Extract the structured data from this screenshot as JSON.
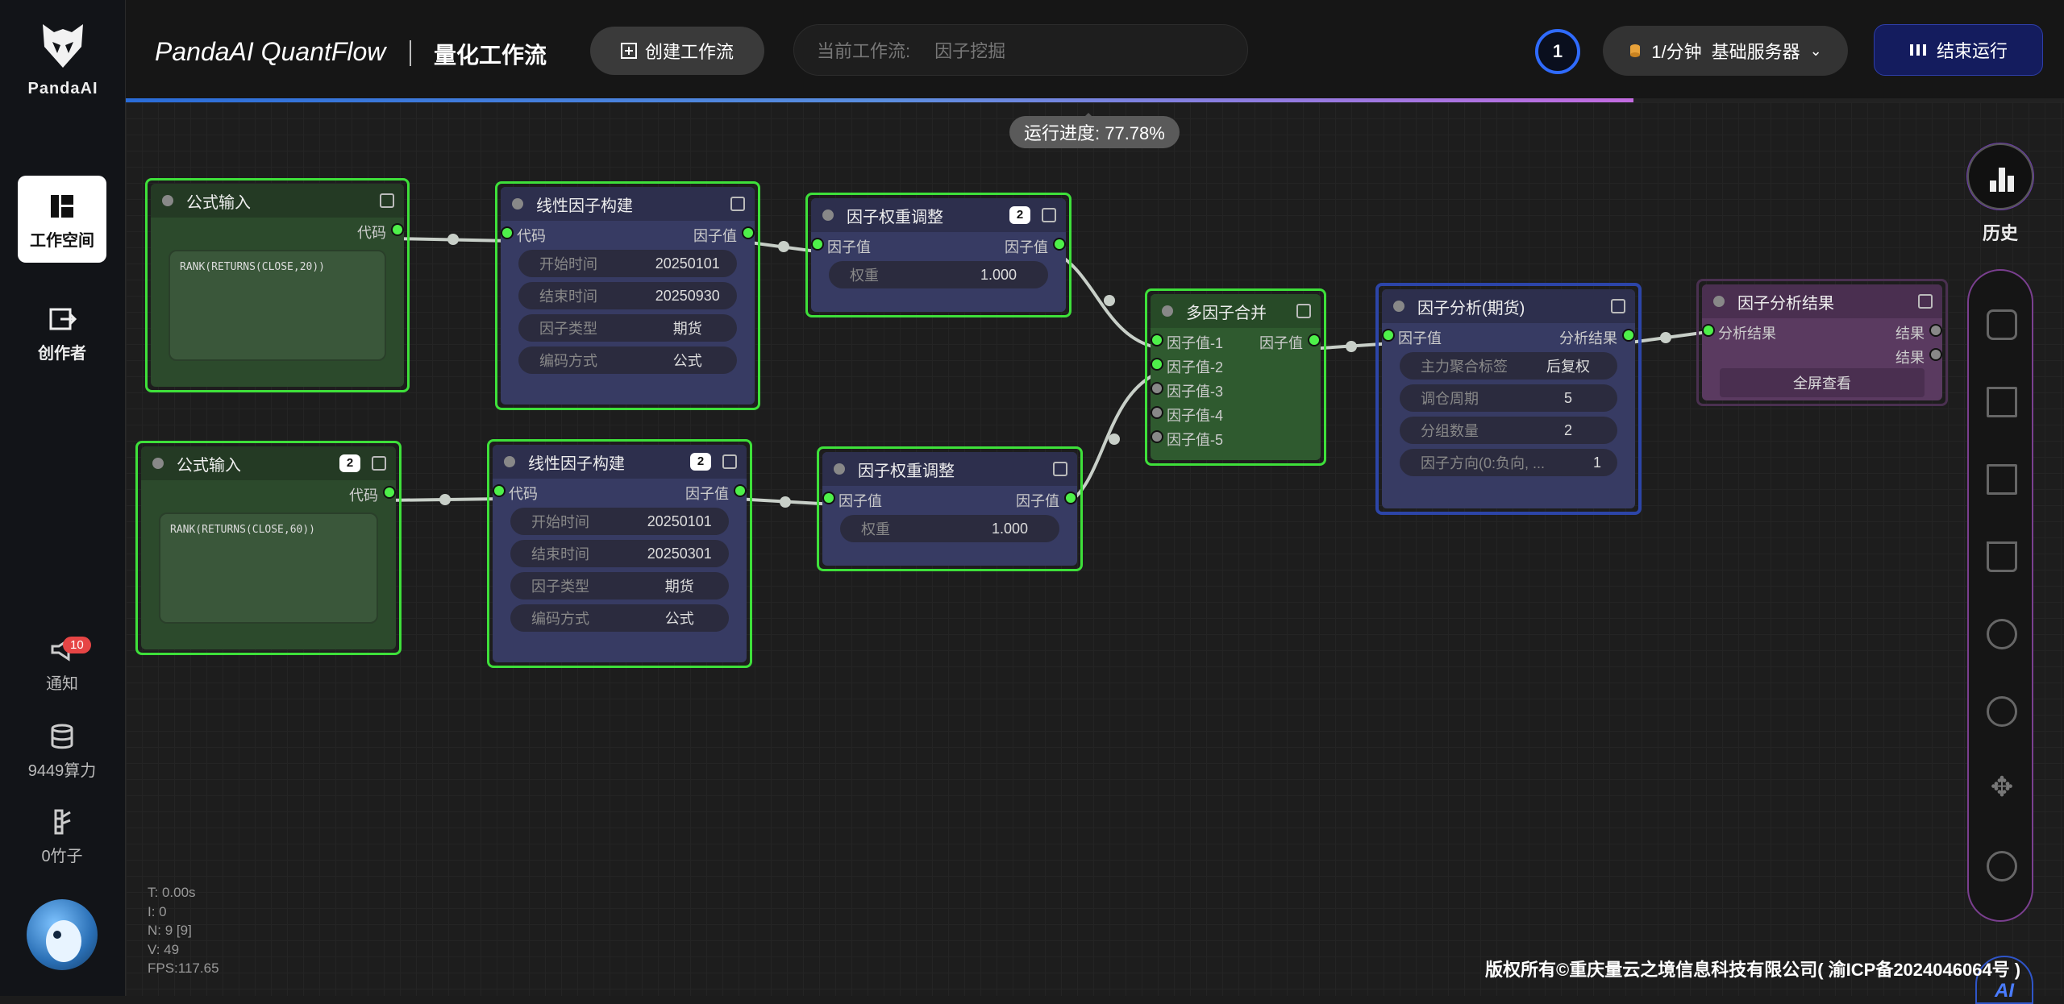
{
  "brand": {
    "logo_text": "PandaAI",
    "title": "PandaAI QuantFlow",
    "subtitle": "量化工作流"
  },
  "sidebar": {
    "items": [
      {
        "label": "工作空间",
        "icon": "workspace-icon"
      },
      {
        "label": "创作者",
        "icon": "logout-icon"
      },
      {
        "label": "通知",
        "icon": "megaphone-icon",
        "badge": "10"
      },
      {
        "label": "9449算力",
        "icon": "database-icon"
      },
      {
        "label": "0竹子",
        "icon": "bamboo-icon"
      }
    ]
  },
  "header": {
    "create_label": "创建工作流",
    "current_label": "当前工作流:",
    "current_value": "因子挖掘",
    "run_count": "1",
    "server_rate": "1/分钟",
    "server_name": "基础服务器",
    "stop_label": "结束运行",
    "progress_percent": 77.78
  },
  "progress_tip": "运行进度: 77.78%",
  "nodes": {
    "formula1": {
      "title": "公式输入",
      "out": "代码",
      "code": "RANK(RETURNS(CLOSE,20))"
    },
    "formula2": {
      "title": "公式输入",
      "count": "2",
      "out": "代码",
      "code": "RANK(RETURNS(CLOSE,60))"
    },
    "linear1": {
      "title": "线性因子构建",
      "in": "代码",
      "out": "因子值",
      "fields": [
        [
          "开始时间",
          "20250101"
        ],
        [
          "结束时间",
          "20250930"
        ],
        [
          "因子类型",
          "期货"
        ],
        [
          "编码方式",
          "公式"
        ]
      ]
    },
    "linear2": {
      "title": "线性因子构建",
      "count": "2",
      "in": "代码",
      "out": "因子值",
      "fields": [
        [
          "开始时间",
          "20250101"
        ],
        [
          "结束时间",
          "20250301"
        ],
        [
          "因子类型",
          "期货"
        ],
        [
          "编码方式",
          "公式"
        ]
      ]
    },
    "weight1": {
      "title": "因子权重调整",
      "count": "2",
      "in": "因子值",
      "out": "因子值",
      "fields": [
        [
          "权重",
          "1.000"
        ]
      ]
    },
    "weight2": {
      "title": "因子权重调整",
      "in": "因子值",
      "out": "因子值",
      "fields": [
        [
          "权重",
          "1.000"
        ]
      ]
    },
    "merge": {
      "title": "多因子合并",
      "ins": [
        "因子值-1",
        "因子值-2",
        "因子值-3",
        "因子值-4",
        "因子值-5"
      ],
      "out": "因子值"
    },
    "analysis": {
      "title": "因子分析(期货)",
      "in": "因子值",
      "out": "分析结果",
      "fields": [
        [
          "主力聚合标签",
          "后复权"
        ],
        [
          "调仓周期",
          "5"
        ],
        [
          "分组数量",
          "2"
        ],
        [
          "因子方向(0:负向, ...",
          "1"
        ]
      ]
    },
    "result": {
      "title": "因子分析结果",
      "in": "分析结果",
      "outs": [
        "结果",
        "结果"
      ],
      "button": "全屏查看"
    }
  },
  "right_toolbar": {
    "history_label": "历史",
    "tools": [
      "save-icon",
      "export-icon",
      "import-icon",
      "trash-icon",
      "zoom-in-icon",
      "zoom-out-icon",
      "fit-view-icon",
      "refresh-icon"
    ],
    "bottom_badge": "AI"
  },
  "stats": {
    "t": "T: 0.00s",
    "i": "I: 0",
    "n": "N: 9 [9]",
    "v": "V: 49",
    "fps": "FPS:117.65"
  },
  "copyright": "版权所有©重庆量云之境信息科技有限公司( 渝ICP备2024046064号 )",
  "colors": {
    "node_border": "#3ee03a",
    "pin": "#4ef04a",
    "accent": "#2f6bff",
    "toolbar_border": "#7a3f8f"
  }
}
